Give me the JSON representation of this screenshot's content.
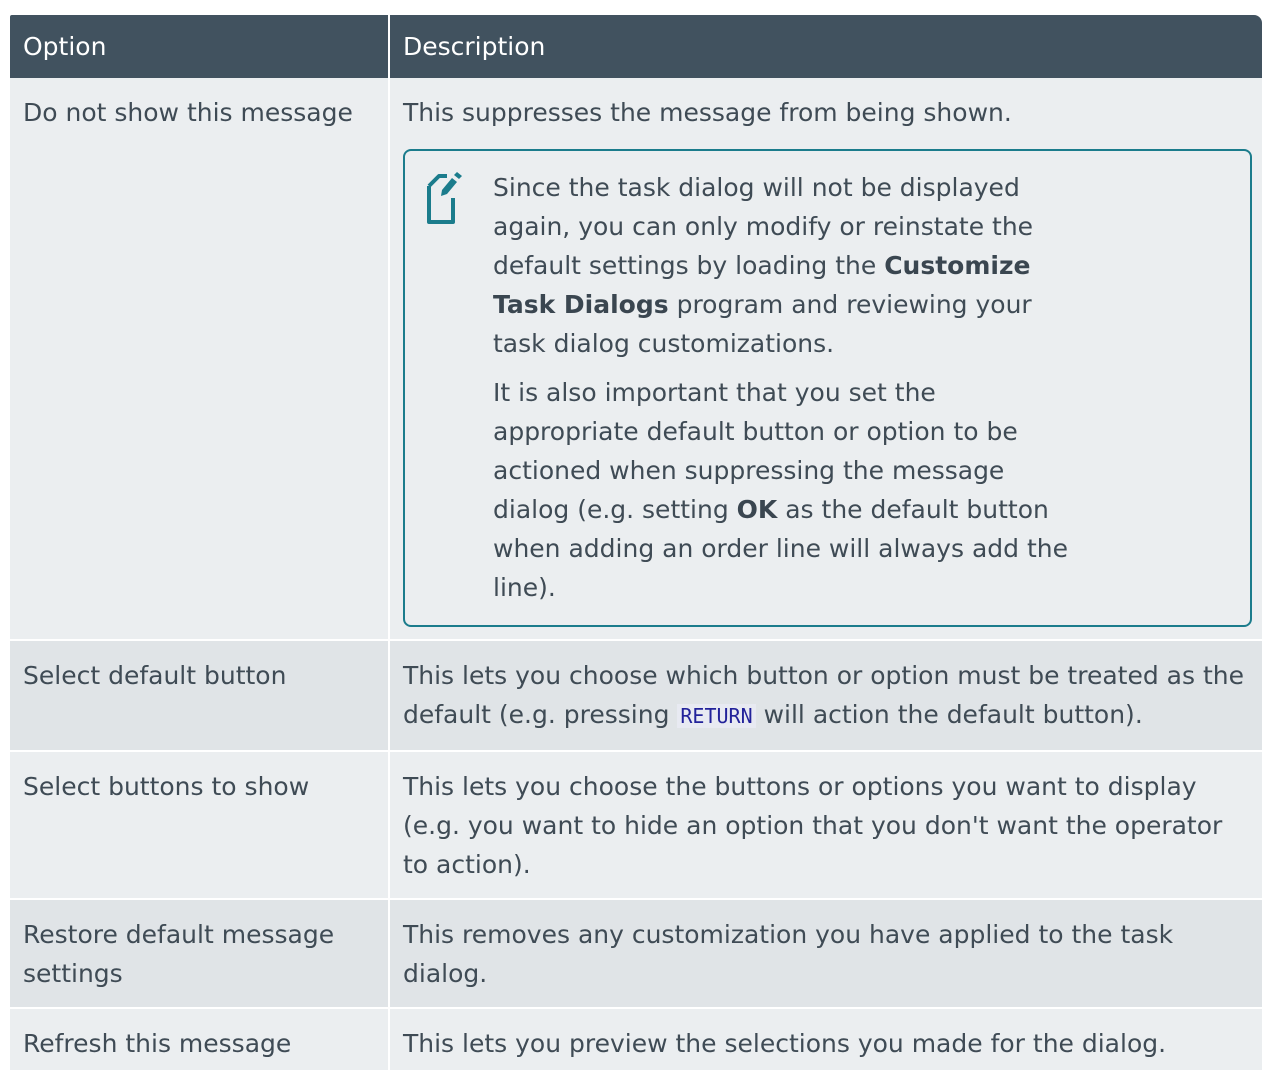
{
  "table": {
    "headers": {
      "option": "Option",
      "description": "Description"
    },
    "rows": [
      {
        "option": "Do not show this message",
        "description": "This suppresses the message from being shown.",
        "note": {
          "icon": "note-pencil-icon",
          "p1_pre": "Since the task dialog will not be displayed again, you can only modify or reinstate the default settings by loading the ",
          "p1_bold": "Customize Task Dialogs",
          "p1_post": " program and reviewing your task dialog customizations.",
          "p2_pre": "It is also important that you set the appropriate default button or option to be actioned when suppressing the message dialog (e.g. setting ",
          "p2_bold": "OK",
          "p2_post": " as the default button when adding an order line will always add the line)."
        }
      },
      {
        "option": "Select default button",
        "description_pre": "This lets you choose which button or option must be treated as the default (e.g. pressing ",
        "description_code": "RETURN",
        "description_post": " will action the default button)."
      },
      {
        "option": "Select buttons to show",
        "description": "This lets you choose the buttons or options you want to display (e.g. you want to hide an option that you don't want the operator to action)."
      },
      {
        "option": "Restore default message settings",
        "description": "This removes any customization you have applied to the task dialog."
      },
      {
        "option": "Refresh this message",
        "description": "This lets you preview the selections you made for the dialog."
      }
    ]
  },
  "colors": {
    "header_bg": "#41525f",
    "row_odd_bg": "#ebeef0",
    "row_even_bg": "#e0e4e7",
    "note_border": "#1b7c8c",
    "code_text": "#22229a"
  }
}
